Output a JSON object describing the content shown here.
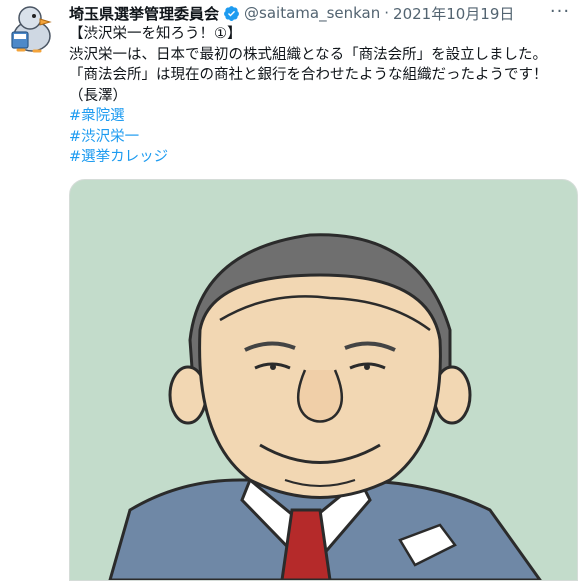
{
  "author": {
    "display_name": "埼玉県選挙管理委員会",
    "handle": "@saitama_senkan",
    "separator": "·",
    "date": "2021年10月19日",
    "verified": true
  },
  "icons": {
    "avatar": "duck-mascot-avatar",
    "verified": "verified-badge-icon",
    "more": "more-options-icon"
  },
  "more_label": "···",
  "tweet": {
    "lines": [
      "【渋沢栄一を知ろう！①】",
      "渋沢栄一は、日本で最初の株式組織となる「商法会所」を設立しました。",
      "「商法会所」は現在の商社と銀行を合わせたような組織だったようです！",
      "（長澤）"
    ],
    "hashtags": [
      "#衆院選",
      "#渋沢栄一",
      "#選挙カレッジ"
    ]
  },
  "media": {
    "description_icon": "shibusawa-eiichi-illustration",
    "background": "#c3dccb"
  },
  "colors": {
    "link": "#1d9bf0",
    "verified": "#1d9bf0",
    "muted": "#536471"
  }
}
